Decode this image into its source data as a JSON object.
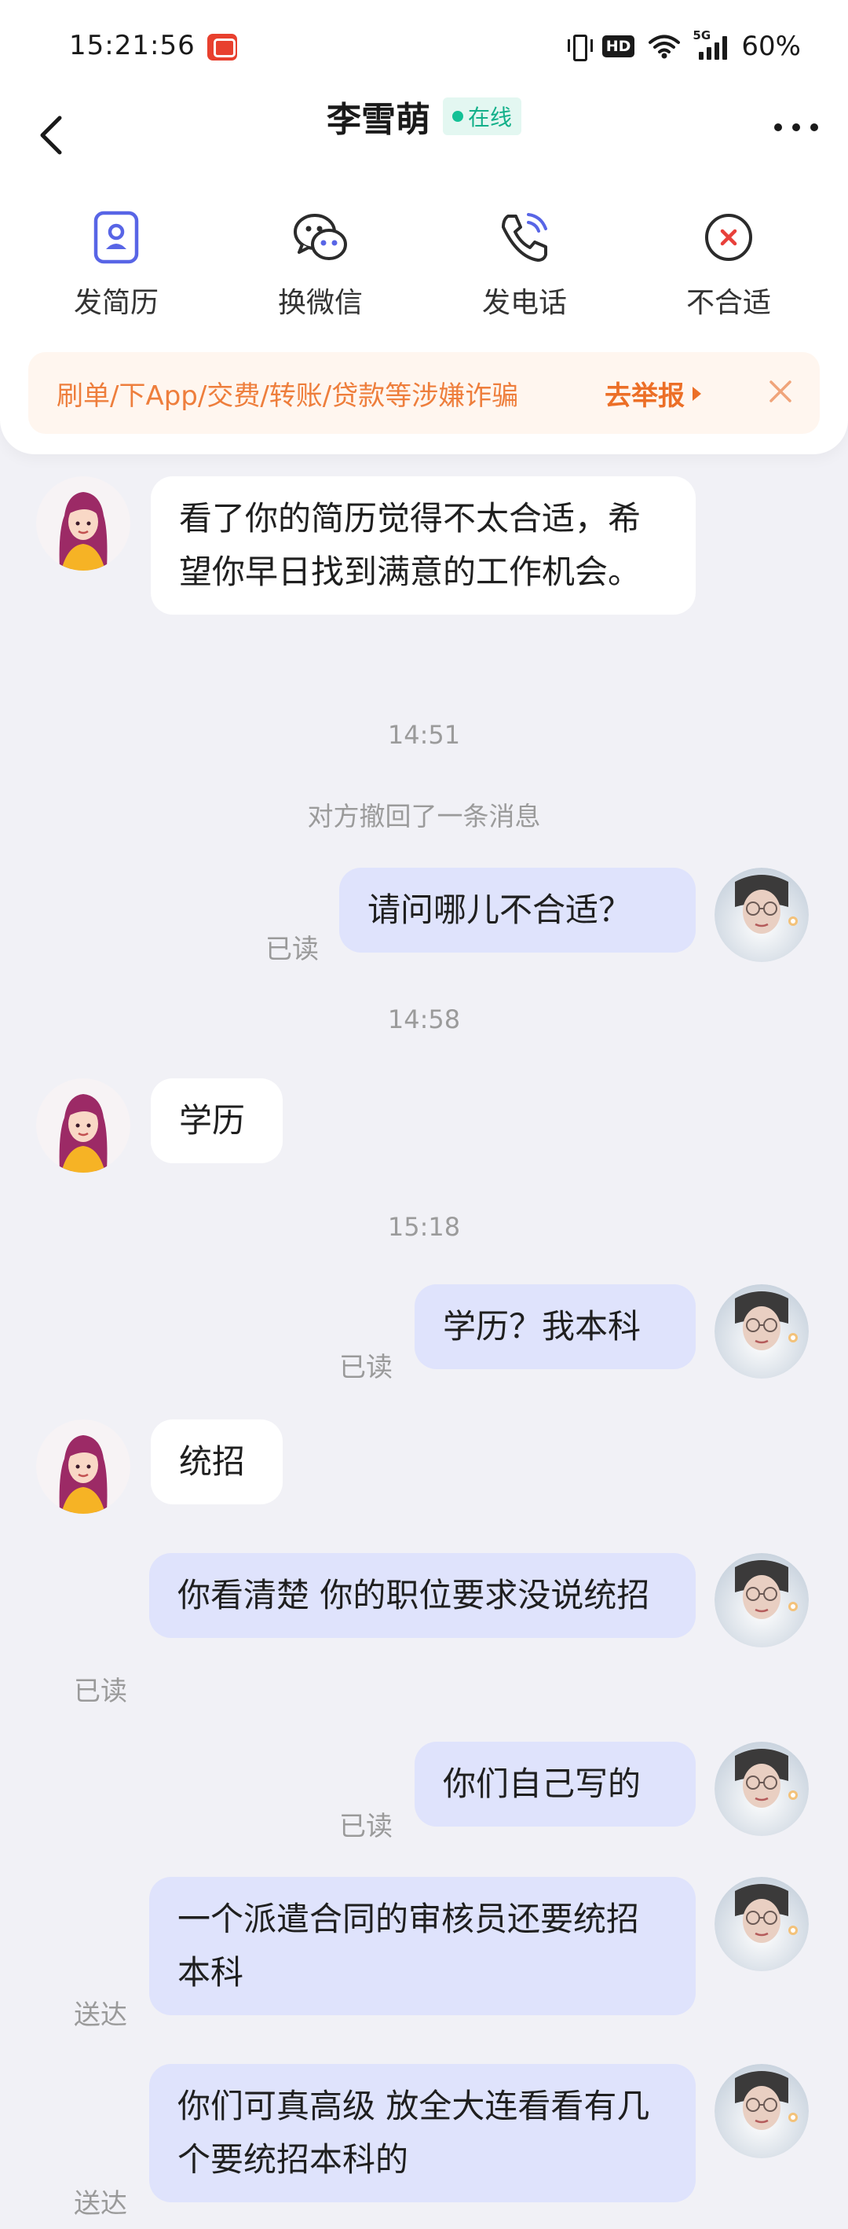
{
  "status_bar": {
    "time": "15:21:56",
    "hd": "HD",
    "network": "5G",
    "battery": "60%"
  },
  "header": {
    "title": "李雪萌",
    "online": "在线"
  },
  "actions": [
    {
      "label": "发简历",
      "icon": "resume-icon"
    },
    {
      "label": "换微信",
      "icon": "wechat-icon"
    },
    {
      "label": "发电话",
      "icon": "phone-icon"
    },
    {
      "label": "不合适",
      "icon": "reject-icon"
    }
  ],
  "notice": {
    "text": "刷单/下App/交费/转账/贷款等涉嫌诈骗",
    "link": "去举报"
  },
  "colors": {
    "accent_blue": "#5865e6",
    "bubble_out": "#dfe3fc",
    "notice_orange": "#ee7e3c",
    "online_green": "#13c196",
    "reject_red": "#e8403a"
  },
  "messages": [
    {
      "from": "them",
      "text": "看了你的简历觉得不太合适，希望你早日找到满意的工作机会。"
    },
    {
      "time": "14:51"
    },
    {
      "system": "对方撤回了一条消息"
    },
    {
      "from": "me",
      "text": "请问哪儿不合适？",
      "receipt": "已读"
    },
    {
      "time": "14:58"
    },
    {
      "from": "them",
      "text": "学历"
    },
    {
      "time": "15:18"
    },
    {
      "from": "me",
      "text": "学历？我本科",
      "receipt": "已读"
    },
    {
      "from": "them",
      "text": "统招"
    },
    {
      "from": "me",
      "text": "你看清楚 你的职位要求没说统招",
      "receipt": "已读"
    },
    {
      "from": "me",
      "text": "你们自己写的",
      "receipt": "已读"
    },
    {
      "from": "me",
      "text": "一个派遣合同的审核员还要统招本科",
      "receipt": "送达"
    },
    {
      "from": "me",
      "text": "你们可真高级 放全大连看看有几个要统招本科的",
      "receipt": "送达"
    }
  ]
}
